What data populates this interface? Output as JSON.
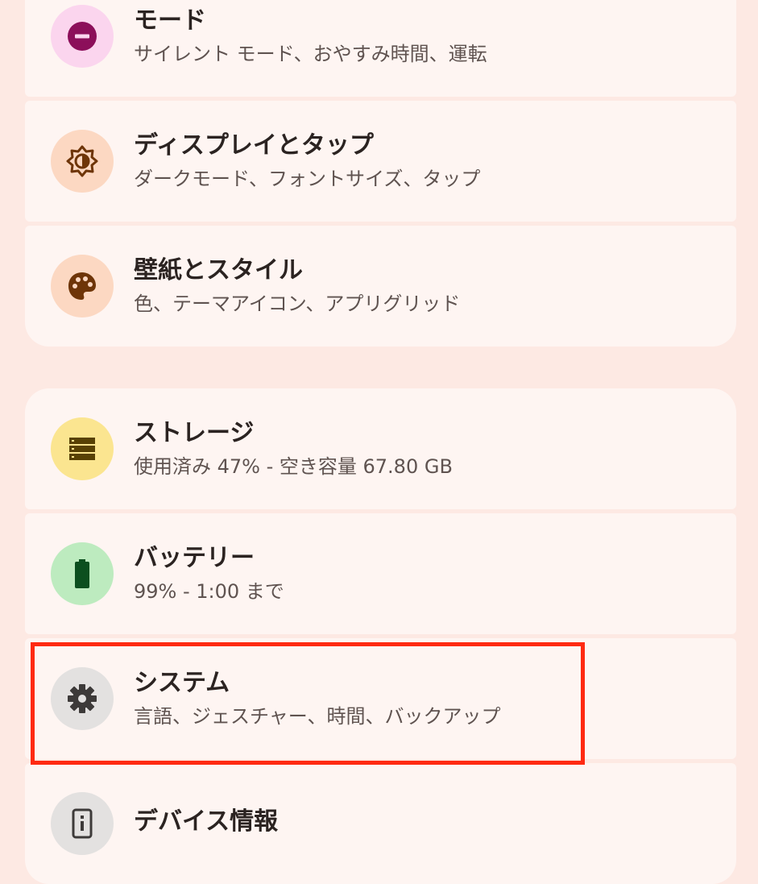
{
  "display_group": [
    {
      "title": "モード",
      "subtitle": "サイレント モード、おやすみ時間、運転",
      "icon": "do-not-disturb-icon",
      "bg": "#fbd5ee",
      "fg": "#8c0f5a"
    },
    {
      "title": "ディスプレイとタップ",
      "subtitle": "ダークモード、フォントサイズ、タップ",
      "icon": "brightness-icon",
      "bg": "#fcd8c2",
      "fg": "#6e3508"
    },
    {
      "title": "壁紙とスタイル",
      "subtitle": "色、テーマアイコン、アプリグリッド",
      "icon": "palette-icon",
      "bg": "#fcd8c2",
      "fg": "#6e3508"
    }
  ],
  "system_group": [
    {
      "title": "ストレージ",
      "subtitle": "使用済み 47% - 空き容量 67.80 GB",
      "icon": "storage-icon",
      "bg": "#fbe590",
      "fg": "#584104"
    },
    {
      "title": "バッテリー",
      "subtitle": "99% - 1:00 まで",
      "icon": "battery-icon",
      "bg": "#bdebbf",
      "fg": "#0c4f1f"
    },
    {
      "title": "システム",
      "subtitle": "言語、ジェスチャー、時間、バックアップ",
      "icon": "gear-icon",
      "bg": "#e3e1e0",
      "fg": "#3d3a39"
    },
    {
      "title": "デバイス情報",
      "subtitle": "",
      "icon": "device-info-icon",
      "bg": "#e3e1e0",
      "fg": "#3d3a39"
    }
  ],
  "highlight_color": "#ff2a12"
}
